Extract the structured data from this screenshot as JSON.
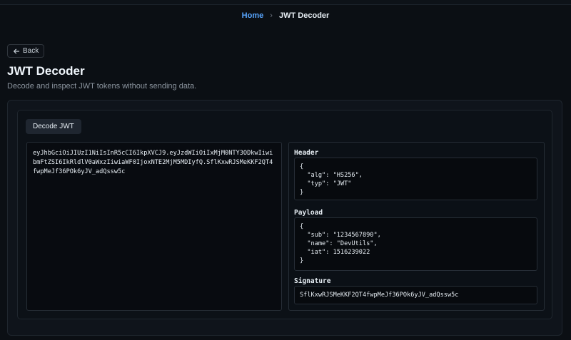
{
  "breadcrumb": {
    "home": "Home",
    "separator": "›",
    "current": "JWT Decoder"
  },
  "back_button": {
    "label": "Back"
  },
  "page": {
    "title": "JWT Decoder",
    "subtitle": "Decode and inspect JWT tokens without sending data."
  },
  "tabs": {
    "decode": "Decode JWT"
  },
  "token_input": {
    "value": "eyJhbGciOiJIUzI1NiIsInR5cCI6IkpXVCJ9.eyJzdWIiOiIxMjM0NTY3ODkwIiwibmFtZSI6IkRldlV0aWxzIiwiaWF0IjoxNTE2MjM5MDIyfQ.SflKxwRJSMeKKF2QT4fwpMeJf36POk6yJV_adQssw5c"
  },
  "decoded": {
    "header_label": "Header",
    "header_json": "{\n  \"alg\": \"HS256\",\n  \"typ\": \"JWT\"\n}",
    "payload_label": "Payload",
    "payload_json": "{\n  \"sub\": \"1234567890\",\n  \"name\": \"DevUtils\",\n  \"iat\": 1516239022\n}",
    "signature_label": "Signature",
    "signature_value": "SflKxwRJSMeKKF2QT4fwpMeJf36POk6yJV_adQssw5c"
  }
}
